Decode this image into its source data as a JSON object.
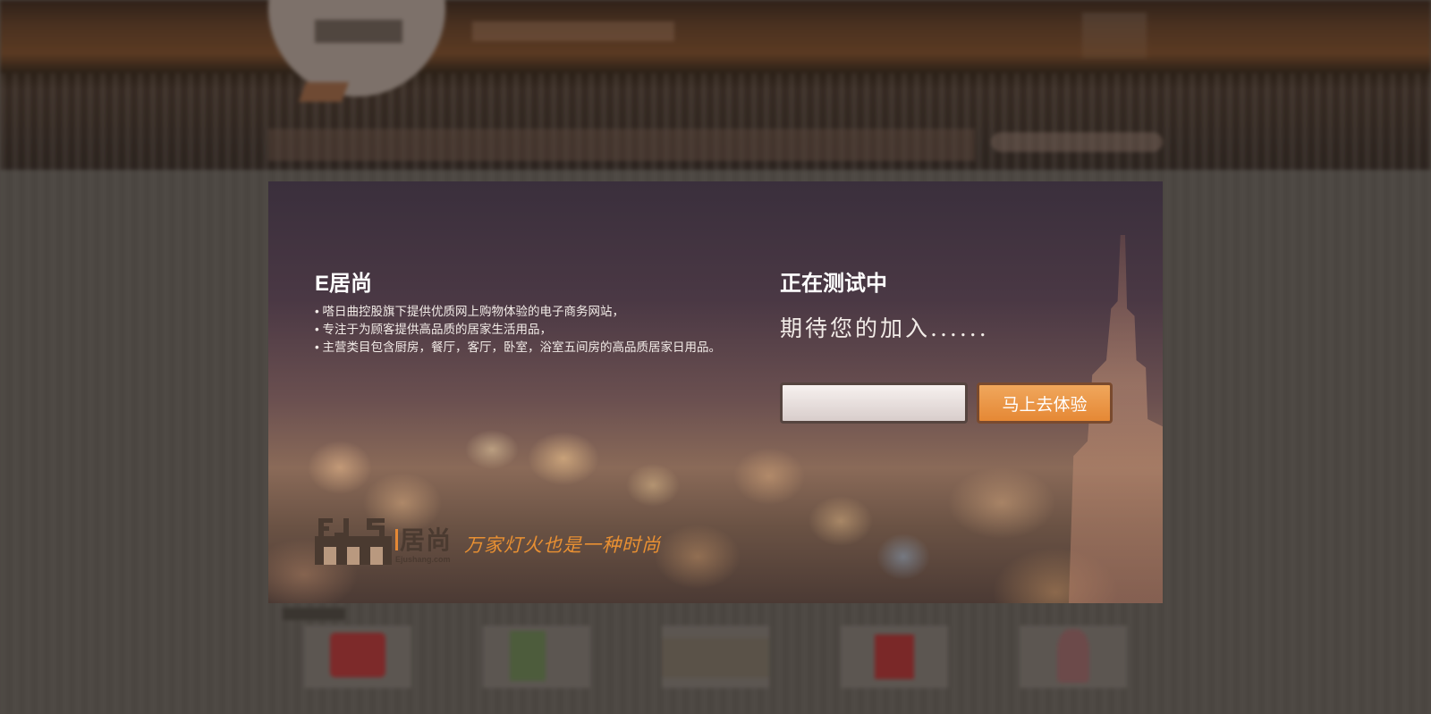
{
  "modal": {
    "brand_title": "E居尚",
    "intro": [
      "嗒日曲控股旗下提供优质网上购物体验的电子商务网站，",
      "专注于为顾客提供高品质的居家生活用品，",
      "主营类目包含厨房，餐厅，客厅，卧室，浴室五间房的高品质居家日用品。"
    ],
    "status_title": "正在测试中",
    "tagline": "期待您的加入......",
    "email_input": {
      "value": "",
      "placeholder": ""
    },
    "go_button_label": "马上去体验",
    "logo": {
      "mark_letters": "EJS",
      "name": "居尚",
      "url": "Ejushang.com",
      "slogan": "万家灯火也是一种时尚"
    }
  },
  "colors": {
    "accent_orange": "#e58835",
    "logo_brown": "#4a3a30",
    "page_overlay": "#4d4843"
  },
  "icons": [
    "ejs-logo-mark"
  ]
}
